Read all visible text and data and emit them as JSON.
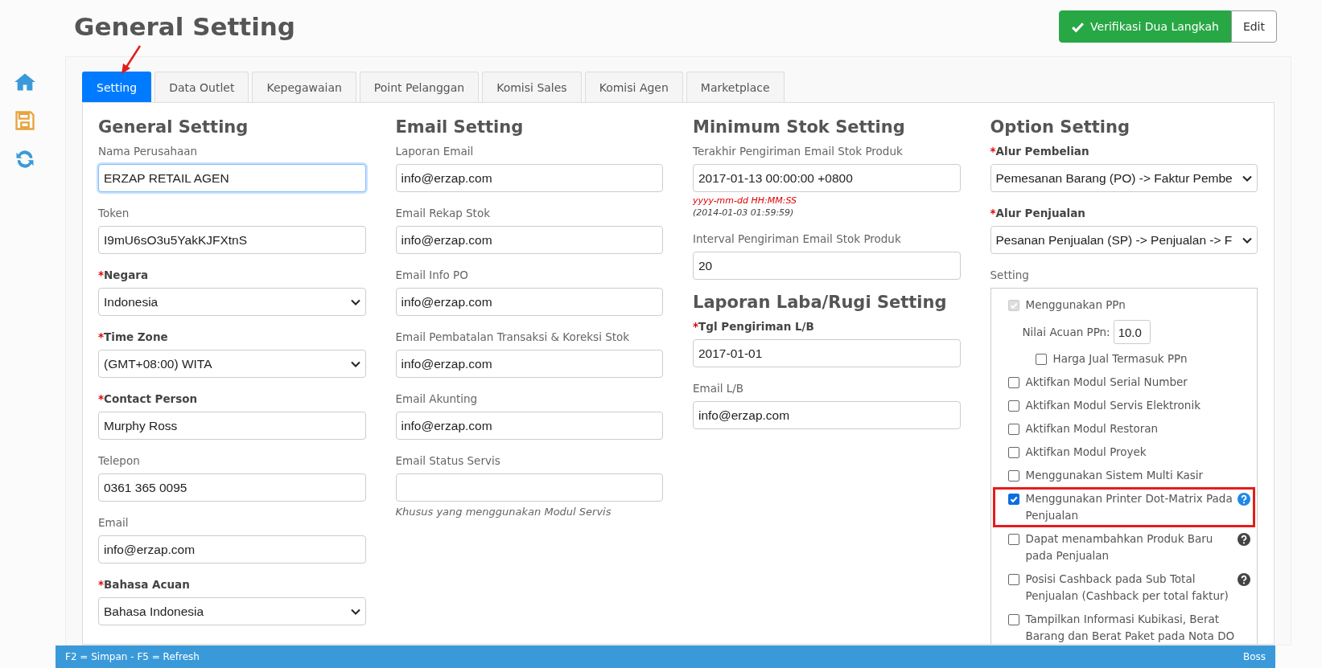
{
  "page_title": "General Setting",
  "header_buttons": [
    {
      "label": "Verifikasi Dua Langkah",
      "kind": "success"
    },
    {
      "label": "Edit",
      "kind": "default"
    }
  ],
  "tabs": [
    {
      "label": "Setting",
      "selected": true
    },
    {
      "label": "Data Outlet",
      "selected": false
    },
    {
      "label": "Kepegawaian",
      "selected": false
    },
    {
      "label": "Point Pelanggan",
      "selected": false
    },
    {
      "label": "Komisi Sales",
      "selected": false
    },
    {
      "label": "Komisi Agen",
      "selected": false
    },
    {
      "label": "Marketplace",
      "selected": false
    }
  ],
  "columns": [
    {
      "sections": [
        {
          "heading": "General Setting",
          "fields": [
            {
              "kind": "input",
              "label": "Nama Perusahaan",
              "required": false,
              "value": "ERZAP RETAIL AGEN",
              "focused": true
            },
            {
              "kind": "input",
              "label": "Token",
              "required": false,
              "value": "I9mU6sO3u5YakKJFXtnS",
              "focused": false
            },
            {
              "kind": "select",
              "label": "Negara",
              "required": true,
              "required_mark": "*",
              "value": "Indonesia",
              "focused": false
            },
            {
              "kind": "select",
              "label": "Time Zone",
              "required": true,
              "required_mark": "*",
              "value": "(GMT+08:00) WITA",
              "focused": false
            },
            {
              "kind": "input",
              "label": "Contact Person",
              "required": true,
              "required_mark": "*",
              "value": "Murphy Ross",
              "focused": false
            },
            {
              "kind": "input",
              "label": "Telepon",
              "required": false,
              "value": "0361 365 0095",
              "focused": false
            },
            {
              "kind": "input",
              "label": "Email",
              "required": false,
              "value": "info@erzap.com",
              "focused": false
            },
            {
              "kind": "select",
              "label": "Bahasa Acuan",
              "required": true,
              "required_mark": "*",
              "value": "Bahasa Indonesia",
              "focused": false
            }
          ]
        }
      ]
    },
    {
      "sections": [
        {
          "heading": "Email Setting",
          "fields": [
            {
              "kind": "input",
              "label": "Laporan Email",
              "required": false,
              "value": "info@erzap.com"
            },
            {
              "kind": "input",
              "label": "Email Rekap Stok",
              "required": false,
              "value": "info@erzap.com"
            },
            {
              "kind": "input",
              "label": "Email Info PO",
              "required": false,
              "value": "info@erzap.com"
            },
            {
              "kind": "input",
              "label": "Email Pembatalan Transaksi & Koreksi Stok",
              "required": false,
              "value": "info@erzap.com"
            },
            {
              "kind": "input",
              "label": "Email Akunting",
              "required": false,
              "value": "info@erzap.com"
            },
            {
              "kind": "input",
              "label": "Email Status Servis",
              "required": false,
              "note": "Khusus yang menggunakan Modul Servis"
            }
          ]
        }
      ]
    },
    {
      "sections": [
        {
          "heading": "Minimum Stok Setting",
          "fields": [
            {
              "kind": "input",
              "label": "Terakhir Pengiriman Email Stok Produk",
              "required": false,
              "value": "2017-01-13 00:00:00 +0800",
              "format_hint": "yyyy-mm-dd HH:MM:SS",
              "example_hint": "(2014-01-03 01:59:59)"
            },
            {
              "kind": "input",
              "label": "Interval Pengiriman Email Stok Produk",
              "required": false,
              "value": "20"
            }
          ]
        },
        {
          "heading": "Laporan Laba/Rugi Setting",
          "fields": [
            {
              "kind": "input",
              "label": "Tgl Pengiriman L/B",
              "required": true,
              "required_mark": "*",
              "value": "2017-01-01"
            },
            {
              "kind": "input",
              "label": "Email L/B",
              "required": false,
              "value": "info@erzap.com"
            }
          ]
        }
      ]
    },
    {
      "sections": [
        {
          "heading": "Option Setting",
          "fields": [
            {
              "kind": "select",
              "label": "Alur Pembelian",
              "required": true,
              "required_mark": "*",
              "value": "Pemesanan Barang (PO) -> Faktur Pembe"
            },
            {
              "kind": "select",
              "label": "Alur Penjualan",
              "required": true,
              "required_mark": "*",
              "value": "Pesanan Penjualan (SP) -> Penjualan -> F"
            },
            {
              "kind": "checklist",
              "label": "Setting",
              "required": false,
              "items": [
                {
                  "kind": "checkbox",
                  "label": "Menggunakan PPn",
                  "checked": true,
                  "disabled": true,
                  "highlighted": false,
                  "children": [
                    {
                      "kind": "number",
                      "label": "Nilai Acuan PPn:",
                      "value": "10.0"
                    },
                    {
                      "kind": "checkbox",
                      "label": "Harga Jual Termasuk PPn",
                      "checked": false,
                      "disabled": false,
                      "highlighted": false
                    }
                  ]
                },
                {
                  "kind": "checkbox",
                  "label": "Aktifkan Modul Serial Number",
                  "checked": false,
                  "disabled": false,
                  "highlighted": false
                },
                {
                  "kind": "checkbox",
                  "label": "Aktifkan Modul Servis Elektronik",
                  "checked": false,
                  "disabled": false,
                  "highlighted": false
                },
                {
                  "kind": "checkbox",
                  "label": "Aktifkan Modul Restoran",
                  "checked": false,
                  "disabled": false,
                  "highlighted": false
                },
                {
                  "kind": "checkbox",
                  "label": "Aktifkan Modul Proyek",
                  "checked": false,
                  "disabled": false,
                  "highlighted": false
                },
                {
                  "kind": "checkbox",
                  "label": "Menggunakan Sistem Multi Kasir",
                  "checked": false,
                  "disabled": false,
                  "highlighted": false
                },
                {
                  "kind": "checkbox",
                  "label": "Menggunakan Printer Dot-Matrix Pada Penjualan",
                  "checked": true,
                  "disabled": false,
                  "highlighted": true,
                  "help": true,
                  "color": "#1e88e5"
                },
                {
                  "kind": "checkbox",
                  "label": "Dapat menambahkan Produk Baru pada Penjualan",
                  "checked": false,
                  "disabled": false,
                  "highlighted": false,
                  "help": true,
                  "color": "#444444"
                },
                {
                  "kind": "checkbox",
                  "label": "Posisi Cashback pada Sub Total Penjualan (Cashback per total faktur)",
                  "checked": false,
                  "disabled": false,
                  "highlighted": false,
                  "help": true,
                  "color": "#444444"
                },
                {
                  "kind": "checkbox",
                  "label": "Tampilkan Informasi Kubikasi, Berat Barang dan Berat Paket pada Nota DO",
                  "checked": false,
                  "disabled": false,
                  "highlighted": false
                }
              ]
            }
          ]
        }
      ]
    }
  ],
  "footer": {
    "shortcuts": "F2 = Simpan - F5 = Refresh",
    "user": "Boss"
  }
}
